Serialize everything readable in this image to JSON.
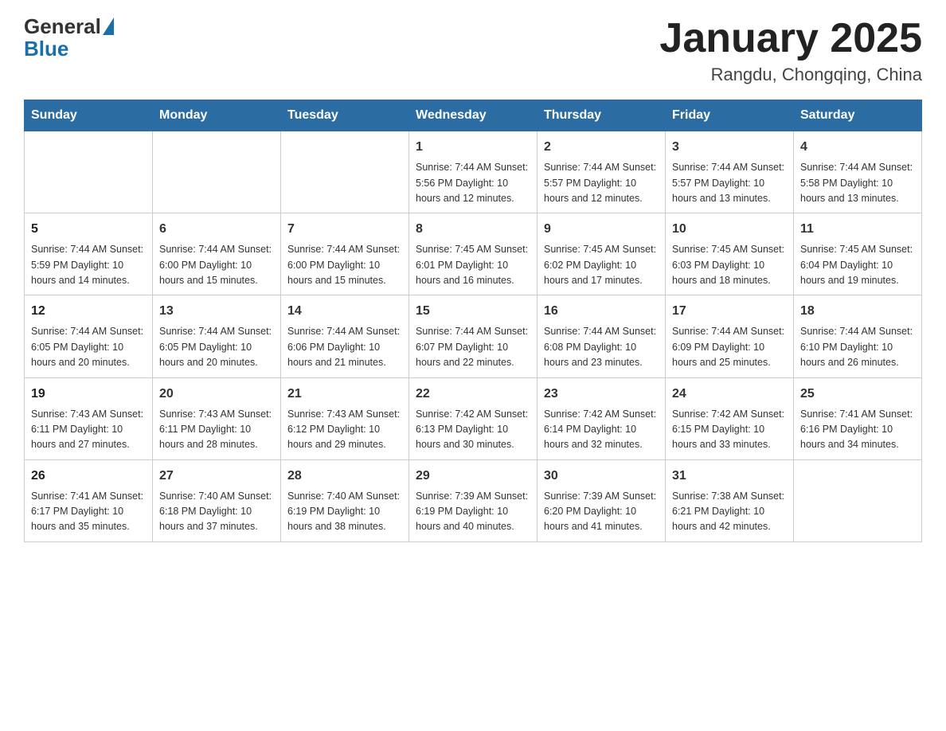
{
  "header": {
    "logo_text_general": "General",
    "logo_text_blue": "Blue",
    "title": "January 2025",
    "subtitle": "Rangdu, Chongqing, China"
  },
  "days_of_week": [
    "Sunday",
    "Monday",
    "Tuesday",
    "Wednesday",
    "Thursday",
    "Friday",
    "Saturday"
  ],
  "weeks": [
    [
      {
        "num": "",
        "info": ""
      },
      {
        "num": "",
        "info": ""
      },
      {
        "num": "",
        "info": ""
      },
      {
        "num": "1",
        "info": "Sunrise: 7:44 AM\nSunset: 5:56 PM\nDaylight: 10 hours\nand 12 minutes."
      },
      {
        "num": "2",
        "info": "Sunrise: 7:44 AM\nSunset: 5:57 PM\nDaylight: 10 hours\nand 12 minutes."
      },
      {
        "num": "3",
        "info": "Sunrise: 7:44 AM\nSunset: 5:57 PM\nDaylight: 10 hours\nand 13 minutes."
      },
      {
        "num": "4",
        "info": "Sunrise: 7:44 AM\nSunset: 5:58 PM\nDaylight: 10 hours\nand 13 minutes."
      }
    ],
    [
      {
        "num": "5",
        "info": "Sunrise: 7:44 AM\nSunset: 5:59 PM\nDaylight: 10 hours\nand 14 minutes."
      },
      {
        "num": "6",
        "info": "Sunrise: 7:44 AM\nSunset: 6:00 PM\nDaylight: 10 hours\nand 15 minutes."
      },
      {
        "num": "7",
        "info": "Sunrise: 7:44 AM\nSunset: 6:00 PM\nDaylight: 10 hours\nand 15 minutes."
      },
      {
        "num": "8",
        "info": "Sunrise: 7:45 AM\nSunset: 6:01 PM\nDaylight: 10 hours\nand 16 minutes."
      },
      {
        "num": "9",
        "info": "Sunrise: 7:45 AM\nSunset: 6:02 PM\nDaylight: 10 hours\nand 17 minutes."
      },
      {
        "num": "10",
        "info": "Sunrise: 7:45 AM\nSunset: 6:03 PM\nDaylight: 10 hours\nand 18 minutes."
      },
      {
        "num": "11",
        "info": "Sunrise: 7:45 AM\nSunset: 6:04 PM\nDaylight: 10 hours\nand 19 minutes."
      }
    ],
    [
      {
        "num": "12",
        "info": "Sunrise: 7:44 AM\nSunset: 6:05 PM\nDaylight: 10 hours\nand 20 minutes."
      },
      {
        "num": "13",
        "info": "Sunrise: 7:44 AM\nSunset: 6:05 PM\nDaylight: 10 hours\nand 20 minutes."
      },
      {
        "num": "14",
        "info": "Sunrise: 7:44 AM\nSunset: 6:06 PM\nDaylight: 10 hours\nand 21 minutes."
      },
      {
        "num": "15",
        "info": "Sunrise: 7:44 AM\nSunset: 6:07 PM\nDaylight: 10 hours\nand 22 minutes."
      },
      {
        "num": "16",
        "info": "Sunrise: 7:44 AM\nSunset: 6:08 PM\nDaylight: 10 hours\nand 23 minutes."
      },
      {
        "num": "17",
        "info": "Sunrise: 7:44 AM\nSunset: 6:09 PM\nDaylight: 10 hours\nand 25 minutes."
      },
      {
        "num": "18",
        "info": "Sunrise: 7:44 AM\nSunset: 6:10 PM\nDaylight: 10 hours\nand 26 minutes."
      }
    ],
    [
      {
        "num": "19",
        "info": "Sunrise: 7:43 AM\nSunset: 6:11 PM\nDaylight: 10 hours\nand 27 minutes."
      },
      {
        "num": "20",
        "info": "Sunrise: 7:43 AM\nSunset: 6:11 PM\nDaylight: 10 hours\nand 28 minutes."
      },
      {
        "num": "21",
        "info": "Sunrise: 7:43 AM\nSunset: 6:12 PM\nDaylight: 10 hours\nand 29 minutes."
      },
      {
        "num": "22",
        "info": "Sunrise: 7:42 AM\nSunset: 6:13 PM\nDaylight: 10 hours\nand 30 minutes."
      },
      {
        "num": "23",
        "info": "Sunrise: 7:42 AM\nSunset: 6:14 PM\nDaylight: 10 hours\nand 32 minutes."
      },
      {
        "num": "24",
        "info": "Sunrise: 7:42 AM\nSunset: 6:15 PM\nDaylight: 10 hours\nand 33 minutes."
      },
      {
        "num": "25",
        "info": "Sunrise: 7:41 AM\nSunset: 6:16 PM\nDaylight: 10 hours\nand 34 minutes."
      }
    ],
    [
      {
        "num": "26",
        "info": "Sunrise: 7:41 AM\nSunset: 6:17 PM\nDaylight: 10 hours\nand 35 minutes."
      },
      {
        "num": "27",
        "info": "Sunrise: 7:40 AM\nSunset: 6:18 PM\nDaylight: 10 hours\nand 37 minutes."
      },
      {
        "num": "28",
        "info": "Sunrise: 7:40 AM\nSunset: 6:19 PM\nDaylight: 10 hours\nand 38 minutes."
      },
      {
        "num": "29",
        "info": "Sunrise: 7:39 AM\nSunset: 6:19 PM\nDaylight: 10 hours\nand 40 minutes."
      },
      {
        "num": "30",
        "info": "Sunrise: 7:39 AM\nSunset: 6:20 PM\nDaylight: 10 hours\nand 41 minutes."
      },
      {
        "num": "31",
        "info": "Sunrise: 7:38 AM\nSunset: 6:21 PM\nDaylight: 10 hours\nand 42 minutes."
      },
      {
        "num": "",
        "info": ""
      }
    ]
  ]
}
